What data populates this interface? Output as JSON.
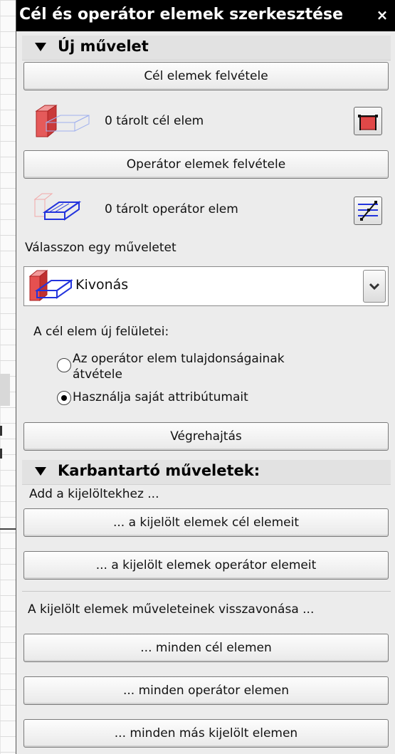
{
  "window": {
    "title": "Cél és operátor elemek szerkesztése",
    "close_glyph": "×"
  },
  "new_operation": {
    "header": "Új művelet",
    "add_target_button": "Cél elemek felvétele",
    "target_count_text": "0 tárolt cél elem",
    "add_operator_button": "Operátor elemek felvétele",
    "operator_count_text": "0 tárolt operátor elem",
    "choose_operation_label": "Válasszon egy műveletet",
    "operation_select": {
      "value": "Kivonás"
    },
    "new_surfaces_label": "A cél elem új felületei:",
    "radio_options": [
      {
        "line1": "Az operátor elem tulajdonságainak",
        "line2": "átvétele",
        "checked": false
      },
      {
        "label": "Használja saját attribútumait",
        "checked": true
      }
    ],
    "execute_button": "Végrehajtás"
  },
  "maintenance": {
    "header": "Karbantartó műveletek:",
    "add_to_selected_label": "Add a kijelöltekhez ...",
    "btn_selected_targets": "... a kijelölt elemek cél elemeit",
    "btn_selected_operators": "... a kijelölt elemek operátor elemeit",
    "undo_label": "A kijelölt elemek műveleteinek visszavonása ...",
    "btn_all_targets": "... minden cél elemen",
    "btn_all_operators": "... minden operátor elemen",
    "btn_all_other": "... minden más kijelölt elemen"
  },
  "colors": {
    "title_bg": "#000000",
    "panel_bg": "#ececec",
    "target_red": "#e05050",
    "operator_blue": "#2233dd"
  }
}
